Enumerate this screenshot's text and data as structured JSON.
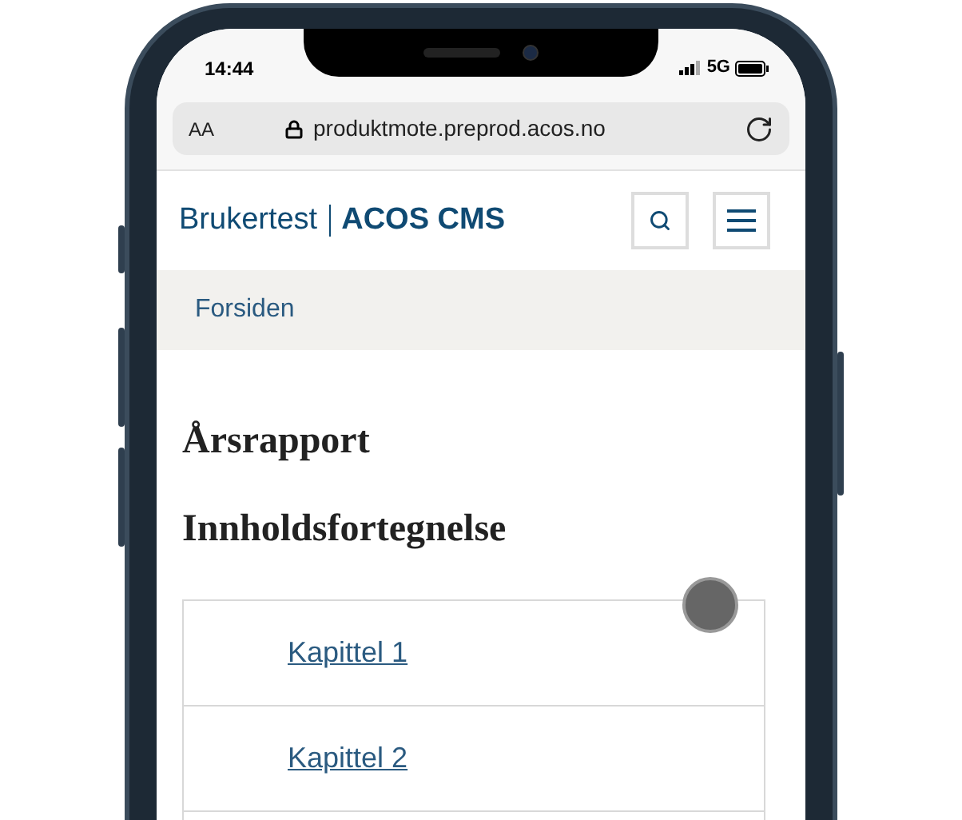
{
  "status_bar": {
    "time": "14:44",
    "network": "5G"
  },
  "address_bar": {
    "text_size": "AA",
    "url": "produktmote.preprod.acos.no"
  },
  "header": {
    "brand": "Brukertest",
    "product": "ACOS CMS"
  },
  "breadcrumb": [
    "Forsiden"
  ],
  "page": {
    "title": "Årsrapport",
    "toc_heading": "Innholdsfortegnelse",
    "toc": [
      "Kapittel 1",
      "Kapittel 2"
    ]
  }
}
